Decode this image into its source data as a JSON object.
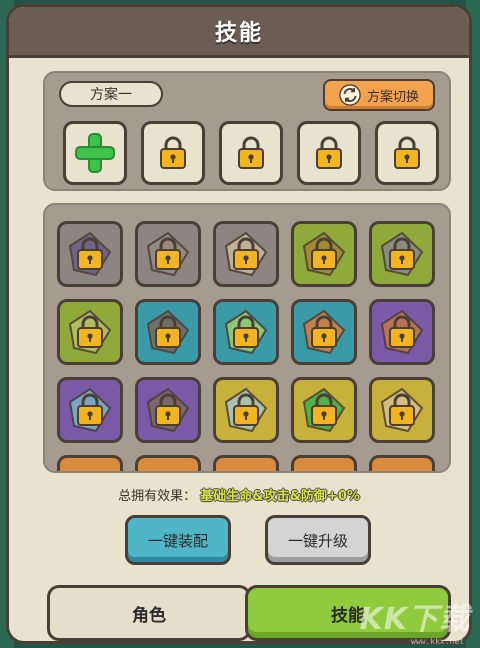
{
  "header": {
    "title": "技能"
  },
  "plan": {
    "label": "方案一",
    "switch_label": "方案切换",
    "slots": [
      {
        "type": "add",
        "icon": "plus-icon"
      },
      {
        "type": "locked",
        "icon": "lock-icon"
      },
      {
        "type": "locked",
        "icon": "lock-icon"
      },
      {
        "type": "locked",
        "icon": "lock-icon"
      },
      {
        "type": "locked",
        "icon": "lock-icon"
      }
    ]
  },
  "skills": [
    {
      "bg": "#8d8580",
      "art": "#6a5f8a"
    },
    {
      "bg": "#8d8580",
      "art": "#9a8a7e"
    },
    {
      "bg": "#8d8580",
      "art": "#c9b89a"
    },
    {
      "bg": "#8fa93a",
      "art": "#a8872f"
    },
    {
      "bg": "#8fa93a",
      "art": "#8a8a8a"
    },
    {
      "bg": "#8fa93a",
      "art": "#b8c06a"
    },
    {
      "bg": "#3a9aa8",
      "art": "#7a6a5e"
    },
    {
      "bg": "#3a9aa8",
      "art": "#9ed06a"
    },
    {
      "bg": "#3a9aa8",
      "art": "#e07d3a"
    },
    {
      "bg": "#7a5aa6",
      "art": "#c57a4a"
    },
    {
      "bg": "#7a5aa6",
      "art": "#7ab4c6"
    },
    {
      "bg": "#7a5aa6",
      "art": "#7a6a5e"
    },
    {
      "bg": "#c8b13a",
      "art": "#a6c6c6"
    },
    {
      "bg": "#c8b13a",
      "art": "#3ab24a"
    },
    {
      "bg": "#c8b13a",
      "art": "#d8c08a"
    }
  ],
  "total": {
    "label": "总拥有效果：",
    "value": "基础生命&攻击&防御+0%"
  },
  "actions": {
    "equip": "一键装配",
    "upgrade": "一键升级"
  },
  "tabs": {
    "role": "角色",
    "skill": "技能"
  },
  "watermark": {
    "text": "KK下载",
    "sub": "www.kkx.net"
  },
  "colors": {
    "accent_green": "#8fcb3c",
    "accent_teal": "#4fb6c7",
    "switch_orange": "#f3a34d",
    "lock_gold": "#f2b41f"
  }
}
